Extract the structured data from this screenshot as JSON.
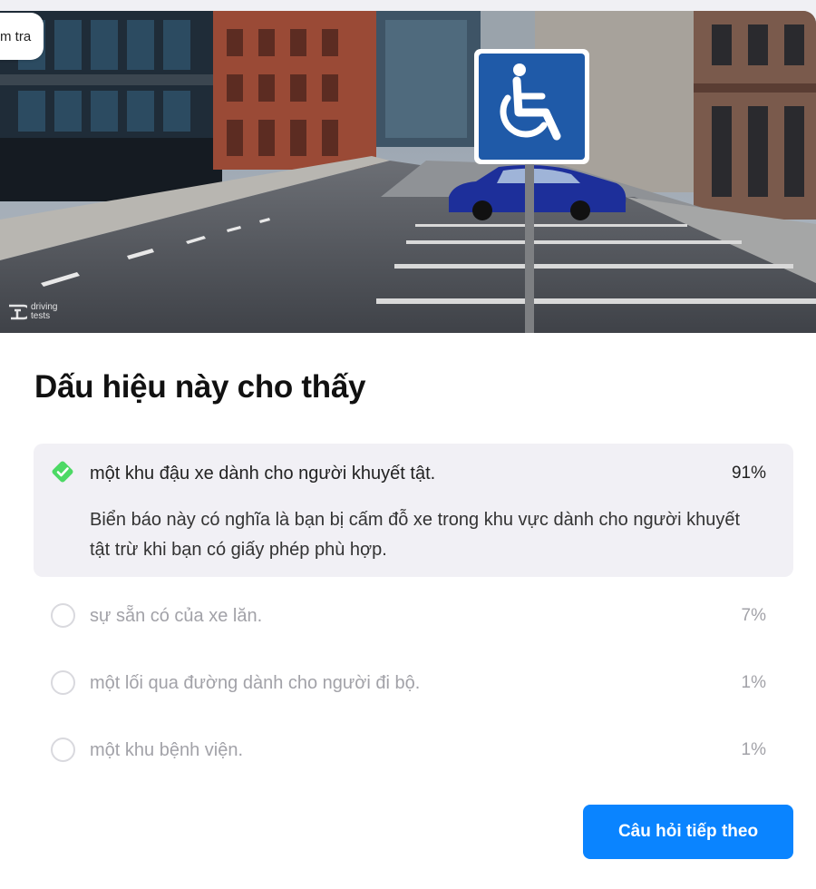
{
  "header": {
    "chip_label": "m tra"
  },
  "image": {
    "watermark": "driving tests"
  },
  "question": {
    "title": "Dấu hiệu này cho thấy"
  },
  "answers": [
    {
      "text": "một khu đậu xe dành cho người khuyết tật.",
      "percent": "91%",
      "state": "correct",
      "explanation": "Biển báo này có nghĩa là bạn bị cấm đỗ xe trong khu vực dành cho người khuyết tật trừ khi bạn có giấy phép phù hợp."
    },
    {
      "text": "sự sẵn có của xe lăn.",
      "percent": "7%",
      "state": "unselected"
    },
    {
      "text": "một lối qua đường dành cho người đi bộ.",
      "percent": "1%",
      "state": "unselected"
    },
    {
      "text": "một khu bệnh viện.",
      "percent": "1%",
      "state": "unselected"
    }
  ],
  "footer": {
    "next_label": "Câu hỏi tiếp theo"
  },
  "colors": {
    "accent": "#0a84ff",
    "correct": "#4cd964",
    "sign_blue": "#1f5aa8"
  },
  "icons": [
    "check-icon",
    "wheelchair-icon"
  ]
}
